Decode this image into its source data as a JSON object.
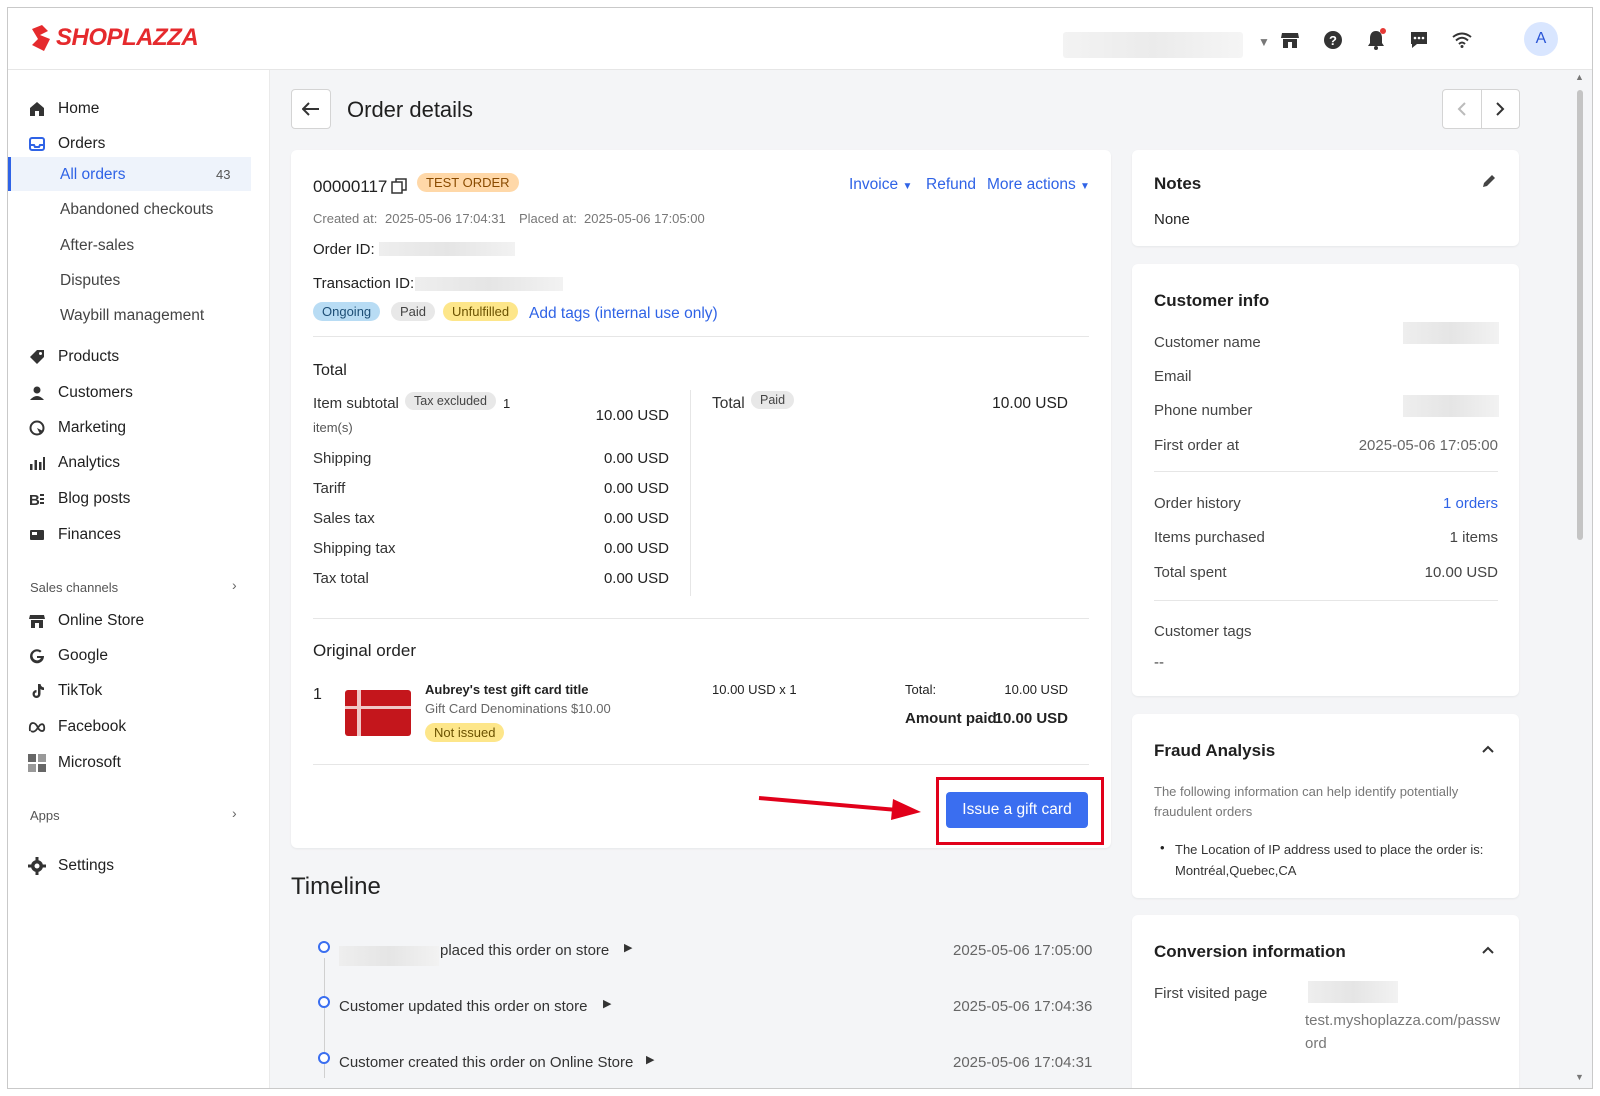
{
  "brand": {
    "name": "SHOPLAZZA",
    "color": "#e52a2d"
  },
  "topbar": {
    "avatar_initial": "A",
    "icons": [
      "store-icon",
      "help-icon",
      "bell-icon",
      "chat-icon",
      "wifi-icon"
    ]
  },
  "sidebar": {
    "home": "Home",
    "orders": "Orders",
    "orders_sub": {
      "all_orders": "All orders",
      "all_orders_count": "43",
      "abandoned": "Abandoned checkouts",
      "after_sales": "After-sales",
      "disputes": "Disputes",
      "waybill": "Waybill management"
    },
    "products": "Products",
    "customers": "Customers",
    "marketing": "Marketing",
    "analytics": "Analytics",
    "blog": "Blog posts",
    "finances": "Finances",
    "sales_channels": "Sales channels",
    "online_store": "Online Store",
    "google": "Google",
    "tiktok": "TikTok",
    "facebook": "Facebook",
    "microsoft": "Microsoft",
    "apps": "Apps",
    "settings": "Settings"
  },
  "page": {
    "title": "Order details"
  },
  "order": {
    "number": "00000117",
    "test_badge": "TEST ORDER",
    "actions": {
      "invoice": "Invoice",
      "refund": "Refund",
      "more": "More actions"
    },
    "created_label": "Created at:",
    "created": "2025-05-06 17:04:31",
    "placed_label": "Placed at:",
    "placed": "2025-05-06 17:05:00",
    "order_id_label": "Order ID:",
    "transaction_id_label": "Transaction ID:",
    "tags": {
      "ongoing": "Ongoing",
      "paid": "Paid",
      "unfulfilled": "Unfulfilled",
      "add": "Add tags (internal use only)"
    },
    "total_section": {
      "title": "Total",
      "item_subtotal": "Item subtotal",
      "tax_excluded": "Tax excluded",
      "items_count": "1",
      "items_unit": "item(s)",
      "item_subtotal_val": "10.00 USD",
      "shipping": "Shipping",
      "shipping_val": "0.00 USD",
      "tariff": "Tariff",
      "tariff_val": "0.00 USD",
      "sales_tax": "Sales tax",
      "sales_tax_val": "0.00 USD",
      "shipping_tax": "Shipping tax",
      "shipping_tax_val": "0.00 USD",
      "tax_total": "Tax total",
      "tax_total_val": "0.00 USD",
      "total": "Total",
      "paid_badge": "Paid",
      "total_val": "10.00 USD"
    },
    "original_order": {
      "title": "Original order",
      "index": "1",
      "item_title": "Aubrey's test gift card title",
      "variant": "Gift Card Denominations $10.00",
      "status": "Not issued",
      "price_qty": "10.00 USD x 1",
      "total_label": "Total:",
      "total_val": "10.00 USD",
      "amount_paid_label": "Amount paid:",
      "amount_paid_val": "10.00 USD"
    },
    "issue_button": "Issue a gift card"
  },
  "timeline": {
    "title": "Timeline",
    "events": [
      {
        "text": "placed this order on store",
        "time": "2025-05-06 17:05:00"
      },
      {
        "text": "Customer updated this order on store",
        "time": "2025-05-06 17:04:36"
      },
      {
        "text": "Customer created this order on Online Store",
        "time": "2025-05-06 17:04:31"
      }
    ]
  },
  "notes": {
    "title": "Notes",
    "value": "None"
  },
  "customer": {
    "title": "Customer info",
    "name_label": "Customer name",
    "email_label": "Email",
    "phone_label": "Phone number",
    "first_order_label": "First order at",
    "first_order_val": "2025-05-06 17:05:00",
    "history_label": "Order history",
    "history_val": "1 orders",
    "items_label": "Items purchased",
    "items_val": "1 items",
    "spent_label": "Total spent",
    "spent_val": "10.00 USD",
    "tags_label": "Customer tags",
    "tags_val": "--"
  },
  "fraud": {
    "title": "Fraud Analysis",
    "desc": "The following information can help identify potentially fraudulent orders",
    "item": "The Location of IP address used to place the order is: Montréal,Quebec,CA"
  },
  "conversion": {
    "title": "Conversion information",
    "first_page_label": "First visited page",
    "first_page_val": "test.myshoplazza.com/password"
  },
  "colors": {
    "accent": "#2f63e6",
    "button": "#3a6ef0",
    "highlight": "#e1001a"
  }
}
